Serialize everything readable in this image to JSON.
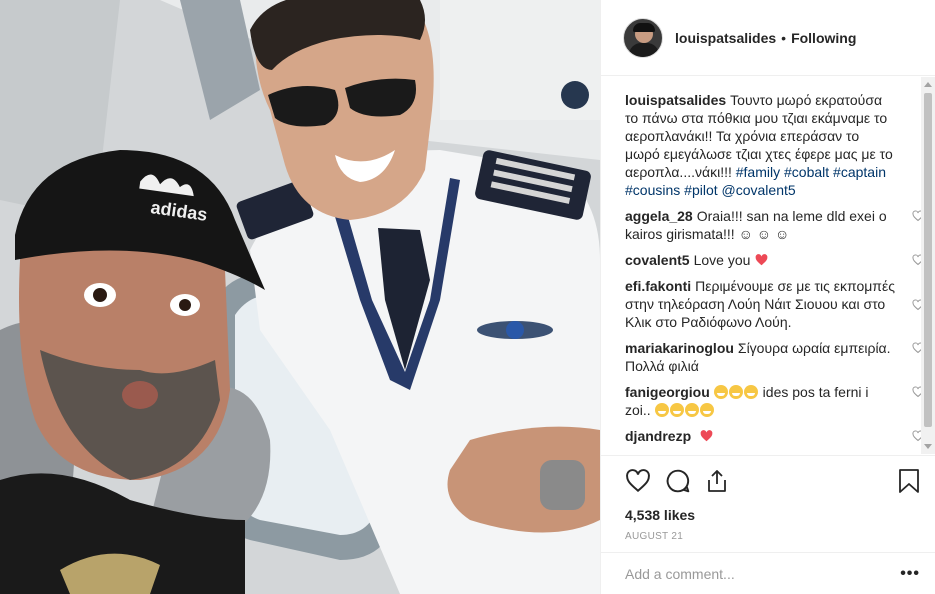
{
  "header": {
    "username": "louispatsalides",
    "separator": "•",
    "follow_status": "Following"
  },
  "caption": {
    "username": "louispatsalides",
    "text_main": "Τουντο μωρό εκρατούσα το πάνω στα πόθκια μου τζιαι εκάμναμε το αεροπλανάκι!! Τα χρόνια επεράσαν το μωρό εμεγάλωσε τζιαι χτες έφερε μας με το αεροπλα....νάκι!!! ",
    "tags": [
      "#family",
      "#cobalt",
      "#captain",
      "#cousins",
      "#pilot",
      "@covalent5"
    ]
  },
  "comments": [
    {
      "username": "aggela_28",
      "text": "Oraia!!! san na leme dld exei o kairos girismata!!! ☺ ☺ ☺"
    },
    {
      "username": "covalent5",
      "text": "Love you"
    },
    {
      "username": "efi.fakonti",
      "text": "Περιμένουμε σε με τις εκπομπές στην τηλεόραση Λούη Νάιτ Σιουου και στο Κλικ στο Ραδιόφωνο Λούη."
    },
    {
      "username": "mariakarinoglou",
      "text": "Σίγουρα ωραία εμπειρία. Πολλά φιλιά"
    },
    {
      "username": "fanigeorgiou",
      "text": "ides pos ta ferni i zoi.."
    },
    {
      "username": "djandrezp",
      "text": ""
    }
  ],
  "likes": "4,538 likes",
  "date": "AUGUST 21",
  "add_comment": {
    "placeholder": "Add a comment...",
    "more": "•••"
  },
  "icons": [
    "heart-icon",
    "comment-icon",
    "share-icon",
    "bookmark-icon"
  ],
  "colors": {
    "link": "#003569",
    "heart_red": "#ed4956",
    "muted": "#999999"
  }
}
